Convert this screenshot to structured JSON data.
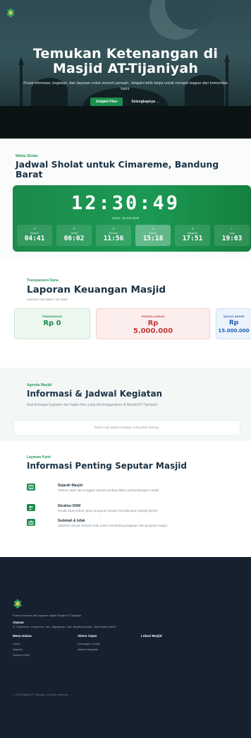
{
  "hero": {
    "title_line1": "Temukan Ketenangan di",
    "title_line2": "Masjid AT-Tijaniyah",
    "subtitle": "Pusat informasi, kegiatan, dan layanan untuk seluruh jamaah. Jelajahi lebih lanjut untuk menjadi bagian dari komunitas kami.",
    "primary_button": "Jelajahi Fitur",
    "secondary_button": "Selengkapnya →"
  },
  "prayer": {
    "kicker": "Waktu Sholat",
    "title": "Jadwal Sholat untuk Cimareme, Bandung Barat",
    "clock": "12:30:49",
    "date": "Senin, 28 Juli 2025",
    "slots": [
      {
        "name": "Subuh",
        "time": "04:41",
        "icon": "sunrise-icon",
        "active": false
      },
      {
        "name": "Terbit",
        "time": "06:02",
        "icon": "sun-icon",
        "active": false
      },
      {
        "name": "Dzuhur",
        "time": "11:56",
        "icon": "sun-icon",
        "active": false
      },
      {
        "name": "Ashar",
        "time": "15:18",
        "icon": "sun-icon",
        "active": true
      },
      {
        "name": "Maghrib",
        "time": "17:51",
        "icon": "sunset-icon",
        "active": false
      },
      {
        "name": "Isya",
        "time": "19:03",
        "icon": "moon-icon",
        "active": false
      }
    ]
  },
  "finance": {
    "kicker": "Transparansi Dana",
    "title": "Laporan Keuangan Masjid",
    "subtitle": "Laporan Kas Bulan Juli 2025",
    "income_label": "PEMASUKAN",
    "income_value": "Rp 0",
    "expense_label": "PENGELUARAN",
    "expense_value_line1": "Rp",
    "expense_value_line2": "5.000.000",
    "balance_label": "SALDO AKHIR",
    "balance_value_line1": "Rp",
    "balance_value_line2": "15.000.000"
  },
  "agenda": {
    "kicker": "Agenda Masjid",
    "title": "Informasi & Jadwal Kegiatan",
    "description": "Ikuti berbagai kegiatan dan kajian ilmu yang diselenggarakan di Masjid AT-Tijaniyah.",
    "empty_text": "Belum ada jadwal kegiatan yang akan datang."
  },
  "services": {
    "kicker": "Layanan Kami",
    "title": "Informasi Penting Seputar Masjid",
    "items": [
      {
        "title": "Sejarah Masjid",
        "desc": "Telusuri jejak dan tonggak sejarah penting dalam perkembangan masjid.",
        "icon": "book-icon"
      },
      {
        "title": "Struktur DKM",
        "desc": "Kenali tokoh-tokoh yang mengurus Dewan Kemakmuran Masjid (DKM).",
        "icon": "users-icon"
      },
      {
        "title": "Sedekah & Infak",
        "desc": "Salurkan donasi terbaik Anda untuk mendukung kegiatan dan program masjid.",
        "icon": "gift-icon"
      }
    ]
  },
  "footer": {
    "description": "Pusat informasi dan layanan digital Masjid AT-Tijaniyah.",
    "address_heading": "Alamat:",
    "address": "Jl. Cimareme, Cimareme, Kec. Ngamprah, Kab. Bandung Barat, Jawa Barat 40552",
    "menu_heading": "Menu Utama",
    "menu_links": [
      "Home",
      "Sejarah",
      "Struktur DKM"
    ],
    "quick_heading": "Akses Cepat",
    "quick_links": [
      "Keuangan & Infak",
      "Jadwal Kegiatan"
    ],
    "location_heading": "Lokasi Masjid",
    "copyright": "© 2025 Masjid AT-Tijaniyah. All rights reserved."
  },
  "colors": {
    "accent_green": "#1a8f4e",
    "footer_bg": "#16212f",
    "expense_red": "#c23a3a",
    "balance_blue": "#1f5fb5"
  }
}
